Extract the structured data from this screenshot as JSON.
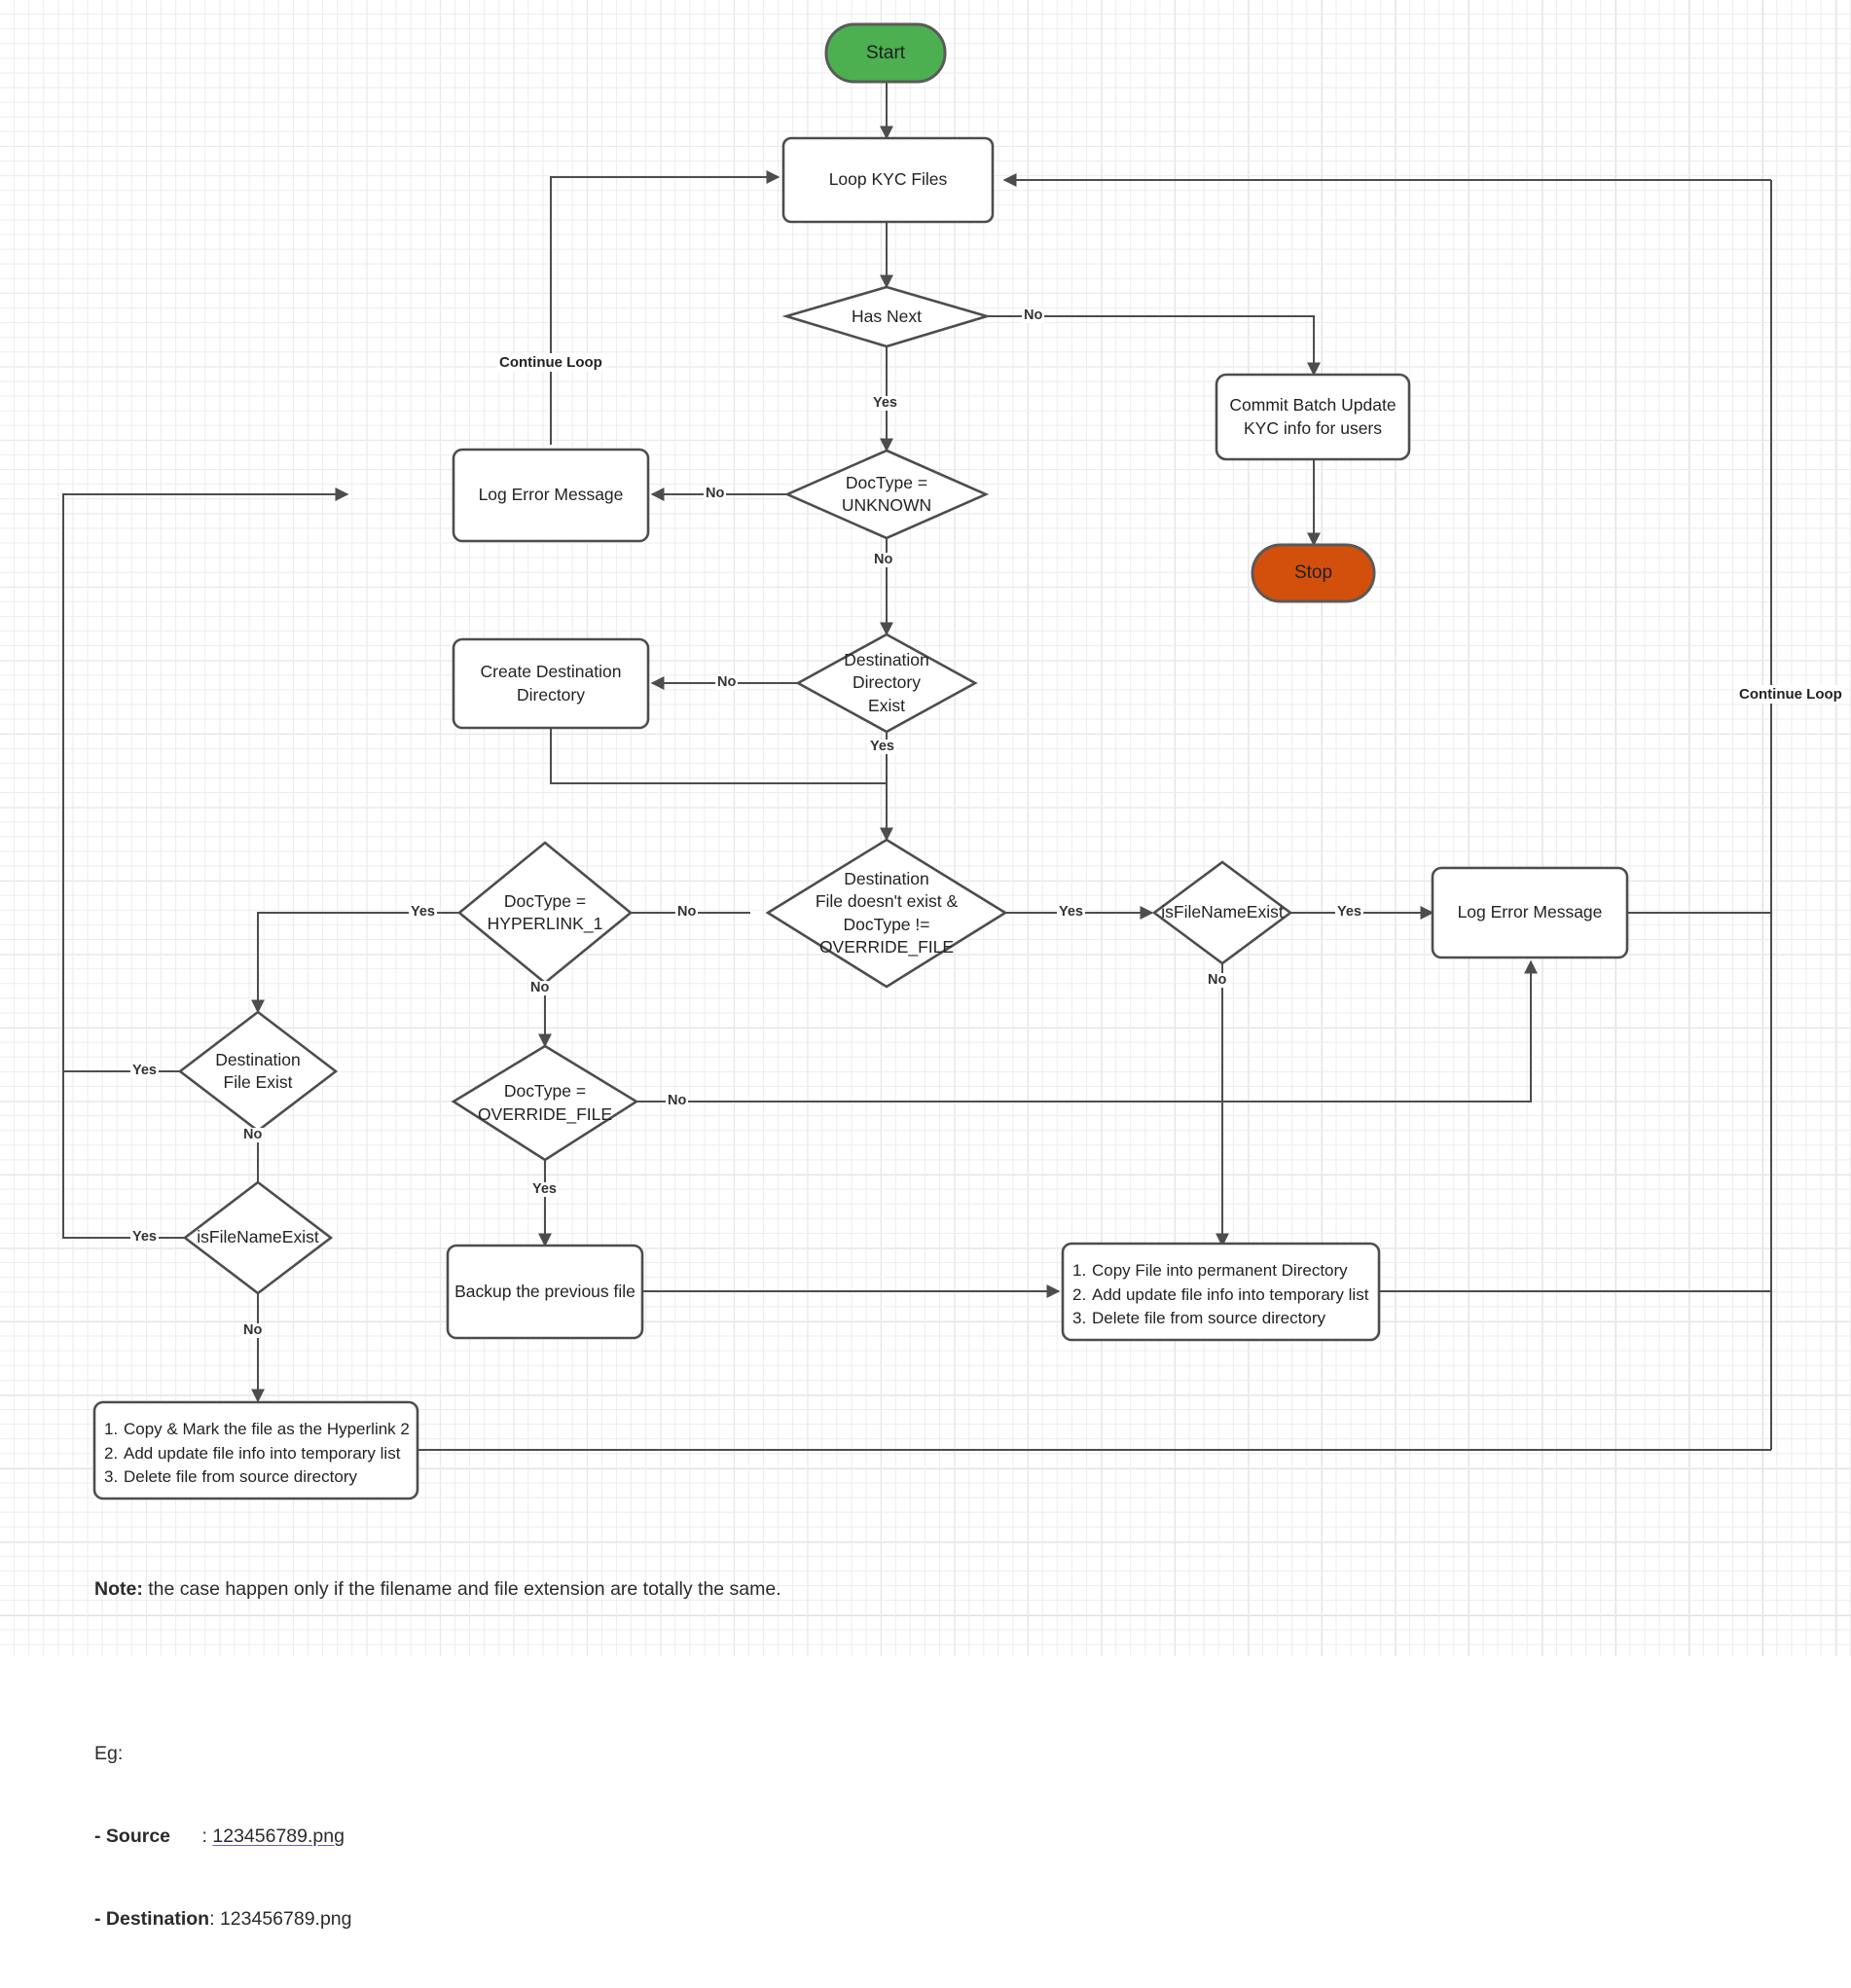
{
  "diagram": {
    "title": "KYC File Processing Flowchart",
    "colors": {
      "start_fill": "#4caf50",
      "stop_fill": "#d3500c",
      "node_stroke": "#4d4d4d",
      "edge_stroke": "#4d4d4d",
      "link_underline": "#6a5acd",
      "grid_minor": "#ececec",
      "grid_major": "#dcdcdc"
    },
    "nodes": {
      "start": {
        "label": "Start",
        "type": "terminator"
      },
      "loop_kyc": {
        "label": "Loop KYC Files",
        "type": "process"
      },
      "has_next": {
        "label": "Has Next",
        "type": "decision"
      },
      "commit_batch": {
        "label": "Commit Batch Update\nKYC info for users",
        "type": "process"
      },
      "stop": {
        "label": "Stop",
        "type": "terminator"
      },
      "doctype_unknown": {
        "label": "DocType =\nUNKNOWN",
        "type": "decision"
      },
      "log_error_1": {
        "label": "Log  Error Message",
        "type": "process"
      },
      "dest_dir_exist": {
        "label": "Destination\nDirectory\nExist",
        "type": "decision"
      },
      "create_dest_dir": {
        "label": "Create Destination\nDirectory",
        "type": "process"
      },
      "dest_file_check": {
        "label": "Destination\nFile doesn't exist &\nDocType !=\nOVERRIDE_FILE",
        "type": "decision"
      },
      "doctype_hyperlink1": {
        "label": "DocType =\nHYPERLINK_1",
        "type": "decision"
      },
      "doctype_override": {
        "label": "DocType =\nOVERRIDE_FILE",
        "type": "decision"
      },
      "is_filename_exist_right": {
        "label": "isFileNameExist",
        "type": "decision"
      },
      "log_error_2": {
        "label": "Log Error Message",
        "type": "process"
      },
      "dest_file_exist": {
        "label": "Destination\nFile Exist",
        "type": "decision"
      },
      "is_filename_exist_left": {
        "label": "isFileNameExist",
        "type": "decision"
      },
      "backup_prev": {
        "label": "Backup the previous file",
        "type": "process"
      },
      "copy_permanent": {
        "type": "process",
        "steps": [
          "Copy File into permanent Directory",
          "Add update file info into temporary list",
          "Delete file from source directory"
        ]
      },
      "copy_hyperlink": {
        "type": "process",
        "steps": [
          "Copy & Mark the file as the Hyperlink 2",
          "Add update file info into temporary list",
          "Delete file from source directory"
        ]
      }
    },
    "edge_labels": {
      "has_next_no": "No",
      "has_next_yes": "Yes",
      "doctype_unknown_no_left": "No",
      "doctype_unknown_no_down": "No",
      "dest_dir_no": "No",
      "dest_dir_yes": "Yes",
      "dest_file_check_no": "No",
      "dest_file_check_yes": "Yes",
      "hyperlink1_yes": "Yes",
      "hyperlink1_no": "No",
      "override_no": "No",
      "override_yes": "Yes",
      "right_filename_yes": "Yes",
      "right_filename_no": "No",
      "dest_file_exist_yes": "Yes",
      "dest_file_exist_no": "No",
      "left_filename_yes": "Yes",
      "left_filename_no": "No"
    },
    "loop_labels": {
      "left": "Continue Loop",
      "right": "Continue Loop"
    },
    "notes": {
      "note_prefix": "Note:",
      "note_body": " the case happen only if the filename and file extension are totally the same.",
      "eg_label": "Eg:",
      "source_label": "- Source",
      "source_sep": "      : ",
      "source_value": "123456789.png",
      "destination_label": "- Destination",
      "destination_sep": ": ",
      "destination_value": "123456789.png"
    }
  }
}
